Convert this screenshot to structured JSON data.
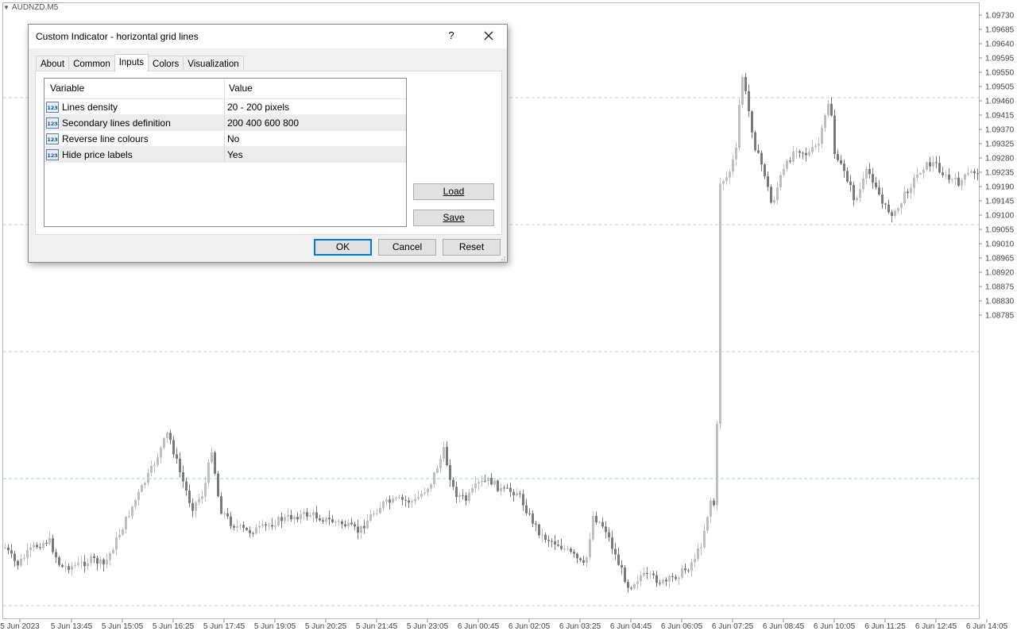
{
  "chart": {
    "symbol": "AUDNZD,M5",
    "price_labels": [
      "1.09730",
      "1.09685",
      "1.09640",
      "1.09595",
      "1.09550",
      "1.09505",
      "1.09460",
      "1.09415",
      "1.09370",
      "1.09325",
      "1.09280",
      "1.09235",
      "1.09190",
      "1.09145",
      "1.09100",
      "1.09055",
      "1.09010",
      "1.08965",
      "1.08920",
      "1.08875",
      "1.08830",
      "1.08785"
    ],
    "time_labels": [
      "5 Jun 2023",
      "5 Jun 13:45",
      "5 Jun 15:05",
      "5 Jun 16:25",
      "5 Jun 17:45",
      "5 Jun 19:05",
      "5 Jun 20:25",
      "5 Jun 21:45",
      "5 Jun 23:05",
      "6 Jun 00:45",
      "6 Jun 02:05",
      "6 Jun 03:25",
      "6 Jun 04:45",
      "6 Jun 06:05",
      "6 Jun 07:25",
      "6 Jun 08:45",
      "6 Jun 10:05",
      "6 Jun 11:25",
      "6 Jun 12:45",
      "6 Jun 14:05"
    ],
    "grid_color": "#d0d0d0",
    "highlight_grid_color": "#9ed6c4",
    "bull_color": "#bfbfbf",
    "bear_color": "#7a7a7a"
  },
  "dialog": {
    "title": "Custom Indicator - horizontal grid lines",
    "help_label": "?",
    "tabs": [
      {
        "label": "About"
      },
      {
        "label": "Common"
      },
      {
        "label": "Inputs",
        "active": true
      },
      {
        "label": "Colors"
      },
      {
        "label": "Visualization"
      }
    ],
    "grid": {
      "headers": {
        "variable": "Variable",
        "value": "Value"
      },
      "rows": [
        {
          "variable": "Lines density",
          "value": "20 - 200 pixels"
        },
        {
          "variable": "Secondary lines definition",
          "value": "200 400 600 800"
        },
        {
          "variable": "Reverse line colours",
          "value": "No"
        },
        {
          "variable": "Hide price labels",
          "value": "Yes"
        }
      ]
    },
    "buttons": {
      "load": "Load",
      "save": "Save",
      "ok": "OK",
      "cancel": "Cancel",
      "reset": "Reset"
    },
    "icons": {
      "param": "int-param-icon",
      "close": "close-icon",
      "grip": "resize-grip-icon"
    }
  }
}
